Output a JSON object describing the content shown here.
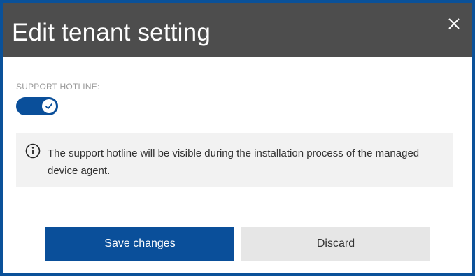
{
  "dialog": {
    "title": "Edit tenant setting",
    "close_icon": "close-icon"
  },
  "setting": {
    "label": "SUPPORT HOTLINE:",
    "toggle_on": true,
    "toggle_icon": "checkmark-icon"
  },
  "info": {
    "icon": "info-icon",
    "text": "The support hotline will be visible during the installation process of the managed device agent."
  },
  "actions": {
    "save_label": "Save changes",
    "discard_label": "Discard"
  },
  "colors": {
    "titlebar": "#4d4d4d",
    "accent": "#0a4f9a",
    "frame": "#0a5199",
    "info_bg": "#f2f2f2",
    "discard_bg": "#e6e6e6"
  }
}
